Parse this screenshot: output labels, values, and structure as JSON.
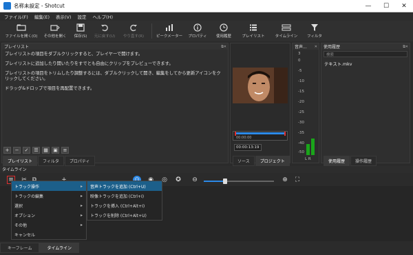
{
  "window": {
    "title": "名称未設定 - Shotcut",
    "minimize": "—",
    "maximize": "☐",
    "close": "✕"
  },
  "menubar": [
    "ファイル(F)",
    "編集(E)",
    "表示(V)",
    "設定",
    "ヘルプ(H)"
  ],
  "toolbar": [
    {
      "label": "ファイルを開く(O)",
      "icon": "folder-icon"
    },
    {
      "label": "その他を開く",
      "icon": "open-other-icon"
    },
    {
      "label": "保存(S)",
      "icon": "save-icon"
    },
    {
      "label": "元に戻す(U)",
      "icon": "undo-icon",
      "disabled": true
    },
    {
      "label": "やり直す(R)",
      "icon": "redo-icon",
      "disabled": true
    },
    {
      "label": "ピークメーター",
      "icon": "peak-meter-icon"
    },
    {
      "label": "プロパティ",
      "icon": "properties-icon"
    },
    {
      "label": "使用履歴",
      "icon": "history-icon"
    },
    {
      "label": "プレイリスト",
      "icon": "playlist-icon"
    },
    {
      "label": "タイムライン",
      "icon": "timeline-icon"
    },
    {
      "label": "フィルタ",
      "icon": "filter-icon"
    }
  ],
  "playlist": {
    "title": "プレイリスト",
    "paragraphs": [
      "プレイリストの項目をダブルクリックすると、プレイヤーで開けます。",
      "プレイリストに追加したり開いたりをすでとも自由にクリップをプレビューできます。",
      "プレイリストの項目をトリムしたり調整するには、ダブルクリックして開き、編集をしてから更新アイコンをクリックしてください。",
      "ドラッグ&ドロップで項目を再配置できます。"
    ],
    "tabs": [
      "プレイリスト",
      "フィルタ",
      "プロパティ"
    ]
  },
  "player": {
    "timecode_in": "00:00:00",
    "timecode_pos": "00:00:13:19",
    "tabs": [
      "ソース",
      "プロジェクト"
    ]
  },
  "audio": {
    "title": "音声...",
    "scale": [
      "3",
      "0",
      "-5",
      "-10",
      "-15",
      "-20",
      "-25",
      "-30",
      "-35",
      "-40",
      "-50"
    ],
    "channels": "L R",
    "level_left": 0.3,
    "level_right": 0.45
  },
  "recent": {
    "title": "使用履歴",
    "search_placeholder": "検索",
    "items": [
      "テキスト.mkv"
    ],
    "tabs": [
      "使用履歴",
      "操作履歴"
    ]
  },
  "timeline": {
    "title": "タイムライン",
    "zoom": 0.3,
    "menu": [
      "トラック操作",
      "トラックの編集",
      "選択",
      "オプション",
      "その他",
      "キャンセル"
    ],
    "submenu": [
      "音声トラックを追加 (Ctrl+U)",
      "映像トラックを追加 (Ctrl+I)",
      "トラックを挿入 (Ctrl+Alt+I)",
      "トラックを削除 (Ctrl+Alt+U)"
    ]
  },
  "bottom_tabs": [
    "キーフレーム",
    "タイムライン"
  ],
  "colors": {
    "accent": "#2c8ae8",
    "highlight": "#1c5f8a",
    "meter": "#1aa51a",
    "record": "#e03030"
  }
}
